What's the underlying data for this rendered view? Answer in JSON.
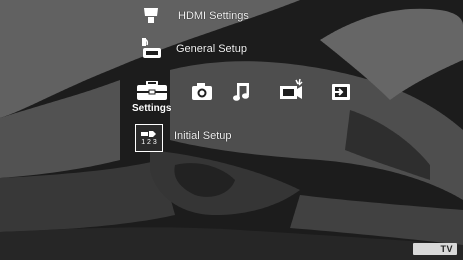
{
  "menu": {
    "above": [
      {
        "label": "HDMI Settings",
        "icon": "hdmi-icon"
      },
      {
        "label": "General Setup",
        "icon": "general-setup-icon"
      }
    ],
    "below": [
      {
        "label": "Initial Setup",
        "icon": "initial-setup-icon",
        "icon_text": "1 2 3"
      }
    ]
  },
  "categories": {
    "selected_label": "Settings",
    "items": [
      {
        "name": "settings",
        "icon": "toolbox-icon"
      },
      {
        "name": "photo",
        "icon": "camera-icon"
      },
      {
        "name": "music",
        "icon": "music-note-icon"
      },
      {
        "name": "video",
        "icon": "video-icon"
      },
      {
        "name": "input",
        "icon": "input-icon"
      }
    ]
  },
  "badge": {
    "text": "TV"
  },
  "colors": {
    "icon": "#ffffff",
    "background": "#1e1e1e",
    "badge": "#d9d9d9"
  }
}
